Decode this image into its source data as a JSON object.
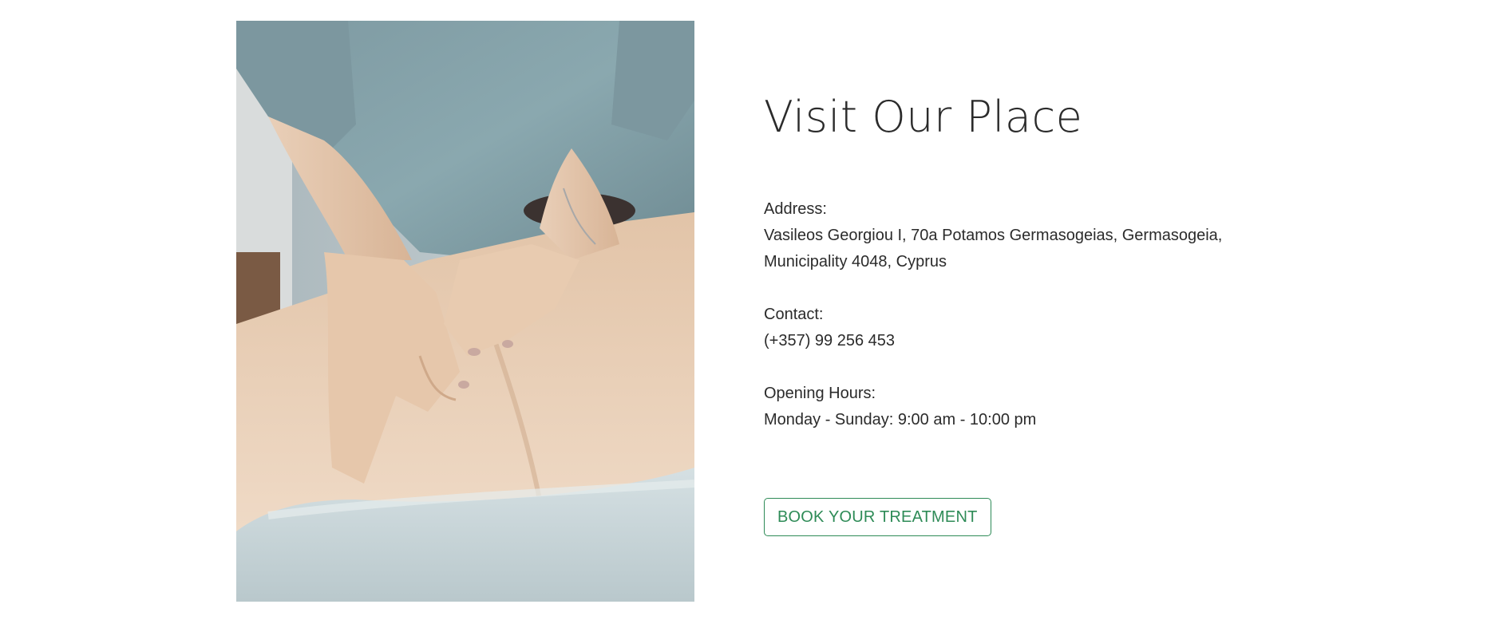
{
  "section": {
    "title": "Visit Our Place",
    "address": {
      "label": "Address:",
      "line1": "Vasileos Georgiou I, 70a Potamos Germasogeias, Germasogeia,",
      "line2": "Municipality 4048, Cyprus"
    },
    "contact": {
      "label": "Contact:",
      "phone": "(+357) 99 256 453"
    },
    "hours": {
      "label": "Opening Hours:",
      "value": "Monday - Sunday: 9:00 am - 10:00 pm"
    },
    "cta": {
      "label": "BOOK YOUR TREATMENT"
    }
  },
  "colors": {
    "accent": "#2e8b57",
    "text": "#2b2b2b",
    "background": "#ffffff"
  }
}
